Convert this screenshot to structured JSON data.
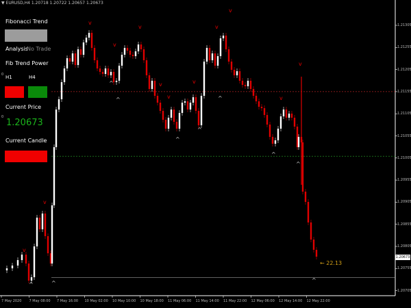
{
  "window": {
    "header": "▼ EURUSD,H4  1.20718 1.20722 1.20657 1.20673"
  },
  "indicator_panel": {
    "title": "Fibonacci Trend",
    "trend_box_color": "#9c9c9c",
    "analysis_label": "Analysis",
    "analysis_value": "No Trade",
    "power_label": "Fib Trend Power",
    "tf_h1": "H1",
    "tf_h4": "H4",
    "h1_color": "#f00000",
    "h4_color": "#0a8a0a",
    "current_price_label": "Current Price",
    "current_price_value": "1.20673",
    "current_candle_label": "Current Candle",
    "current_candle_color": "#f00000",
    "edge_marks": [
      "0",
      "0"
    ]
  },
  "y_axis": {
    "labels": [
      "1.21305",
      "1.21255",
      "1.21205",
      "1.21155",
      "1.21105",
      "1.21055",
      "1.21005",
      "1.20955",
      "1.20905",
      "1.20855",
      "1.20805",
      "1.20755",
      "1.20705"
    ],
    "current_price_badge": "1.20673",
    "top_value": 1.21305,
    "bottom_value": 1.20655
  },
  "x_axis": {
    "labels": [
      "7 May 2020",
      "7 May 08:00",
      "7 May 16:00",
      "10 May 02:00",
      "10 May 10:00",
      "10 May 18:00",
      "11 May 06:00",
      "11 May 14:00",
      "11 May 22:00",
      "12 May 06:00",
      "12 May 14:00",
      "12 May 22:00"
    ]
  },
  "levels": {
    "upper_red_dotted": 1.21105,
    "green_dotted": 1.20955,
    "current_price_line": 1.20673
  },
  "pips_label": "← 22.13",
  "colors": {
    "bull": "#ffffff",
    "bear": "#e00000",
    "level_red": "#b22222",
    "level_green": "#228b22",
    "signal_up": "#d0d0d0",
    "signal_down": "#e00000",
    "grid_price_line": "#9a9a9a"
  }
}
